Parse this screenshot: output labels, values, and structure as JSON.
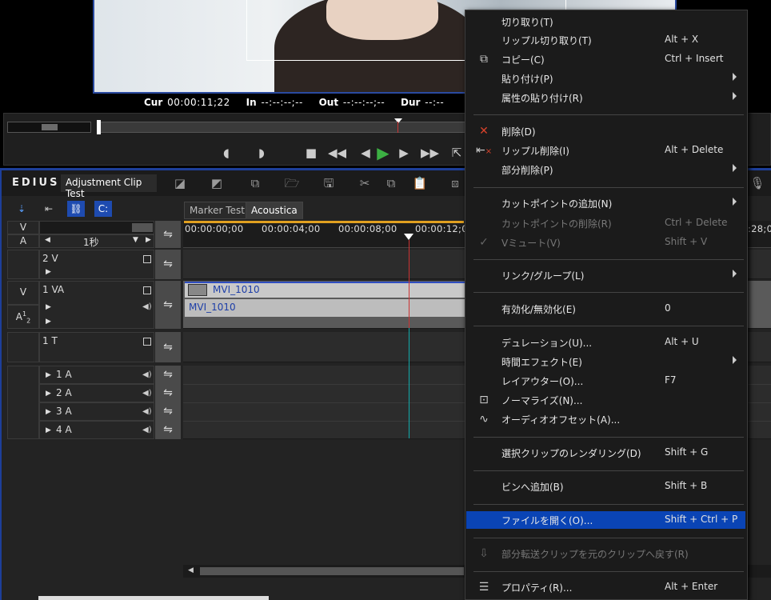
{
  "preview": {
    "timecodes": [
      {
        "label": "Cur",
        "value": "00:00:11;22"
      },
      {
        "label": "In",
        "value": "--:--:--;--"
      },
      {
        "label": "Out",
        "value": "--:--:--;--"
      },
      {
        "label": "Dur",
        "value": "--:--"
      }
    ]
  },
  "app": {
    "logo": "EDIUS",
    "project_name": "Adjustment Clip Test"
  },
  "timeline": {
    "tabs": [
      "Marker Test",
      "Acoustica"
    ],
    "active_tab": "Acoustica",
    "ruler_labels": [
      "00:00:00;00",
      "00:00:04;00",
      "00:00:08;00",
      "00:00:12;0",
      ":28;0"
    ],
    "scale_label": "1秒",
    "header": {
      "v": "V",
      "a": "A"
    },
    "tracks": [
      {
        "name": "2 V"
      },
      {
        "name": "1 VA",
        "patch_v": "V",
        "patch_a": "A",
        "patch_a_sup": "1",
        "patch_a_sub": "2"
      },
      {
        "name": "1 T"
      },
      {
        "name": "1 A"
      },
      {
        "name": "2 A"
      },
      {
        "name": "3 A"
      },
      {
        "name": "4 A"
      }
    ],
    "clip_video_name": "MVI_1010",
    "clip_audio_name": "MVI_1010"
  },
  "context_menu": {
    "items": [
      {
        "label": "切り取り(T)",
        "shortcut": ""
      },
      {
        "label": "リップル切り取り(T)",
        "shortcut": "Alt + X"
      },
      {
        "label": "コピー(C)",
        "shortcut": "Ctrl + Insert",
        "icon": "copy-icon"
      },
      {
        "label": "貼り付け(P)",
        "shortcut": "",
        "submenu": true
      },
      {
        "label": "属性の貼り付け(R)",
        "shortcut": "",
        "submenu": true
      },
      {
        "label": "削除(D)",
        "shortcut": "",
        "icon": "delete-x-icon"
      },
      {
        "label": "リップル削除(I)",
        "shortcut": "Alt + Delete",
        "icon": "ripple-delete-icon"
      },
      {
        "label": "部分削除(P)",
        "shortcut": "",
        "submenu": true
      },
      {
        "label": "カットポイントの追加(N)",
        "shortcut": "",
        "submenu": true
      },
      {
        "label": "カットポイントの削除(R)",
        "shortcut": "Ctrl + Delete",
        "disabled": true
      },
      {
        "label": "Vミュート(V)",
        "shortcut": "Shift + V",
        "disabled": true,
        "icon": "v-mute-icon"
      },
      {
        "label": "リンク/グループ(L)",
        "shortcut": "",
        "submenu": true
      },
      {
        "label": "有効化/無効化(E)",
        "shortcut": "0"
      },
      {
        "label": "デュレーション(U)...",
        "shortcut": "Alt + U"
      },
      {
        "label": "時間エフェクト(E)",
        "shortcut": "",
        "submenu": true
      },
      {
        "label": "レイアウター(O)...",
        "shortcut": "F7"
      },
      {
        "label": "ノーマライズ(N)...",
        "shortcut": "",
        "icon": "normalize-icon"
      },
      {
        "label": "オーディオオフセット(A)...",
        "shortcut": "",
        "icon": "audio-offset-icon"
      },
      {
        "label": "選択クリップのレンダリング(D)",
        "shortcut": "Shift + G"
      },
      {
        "label": "ビンへ追加(B)",
        "shortcut": "Shift + B"
      },
      {
        "label": "ファイルを開く(O)...",
        "shortcut": "Shift + Ctrl + P",
        "selected": true
      },
      {
        "label": "部分転送クリップを元のクリップへ戻す(R)",
        "shortcut": "",
        "disabled": true,
        "icon": "restore-icon"
      },
      {
        "label": "プロパティ(R)...",
        "shortcut": "Alt + Enter",
        "icon": "properties-icon"
      }
    ]
  },
  "colors": {
    "accent_blue": "#1d3f9a",
    "menu_selected": "#0a44b5",
    "play_green": "#3cb043",
    "playhead_teal": "#11aaaa",
    "ruler_orange": "#e0a020"
  }
}
